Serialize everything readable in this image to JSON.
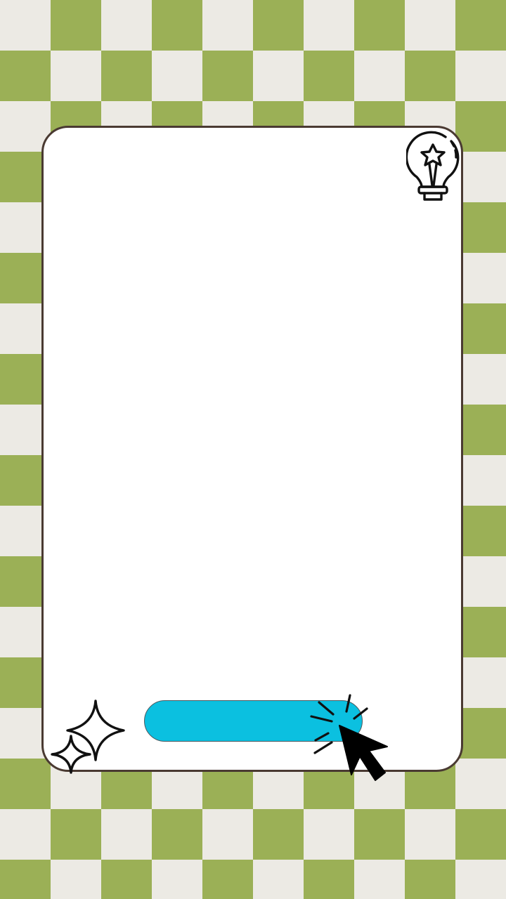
{
  "pill_button": {
    "label": ""
  },
  "icons": [
    "lightbulb-star-icon",
    "sparkle-icon",
    "cursor-click-icon"
  ],
  "colors": {
    "check_green": "#9bb056",
    "check_cream": "#eceae4",
    "card_border": "#4a3a32",
    "pill_fill": "#0bc0e0"
  }
}
